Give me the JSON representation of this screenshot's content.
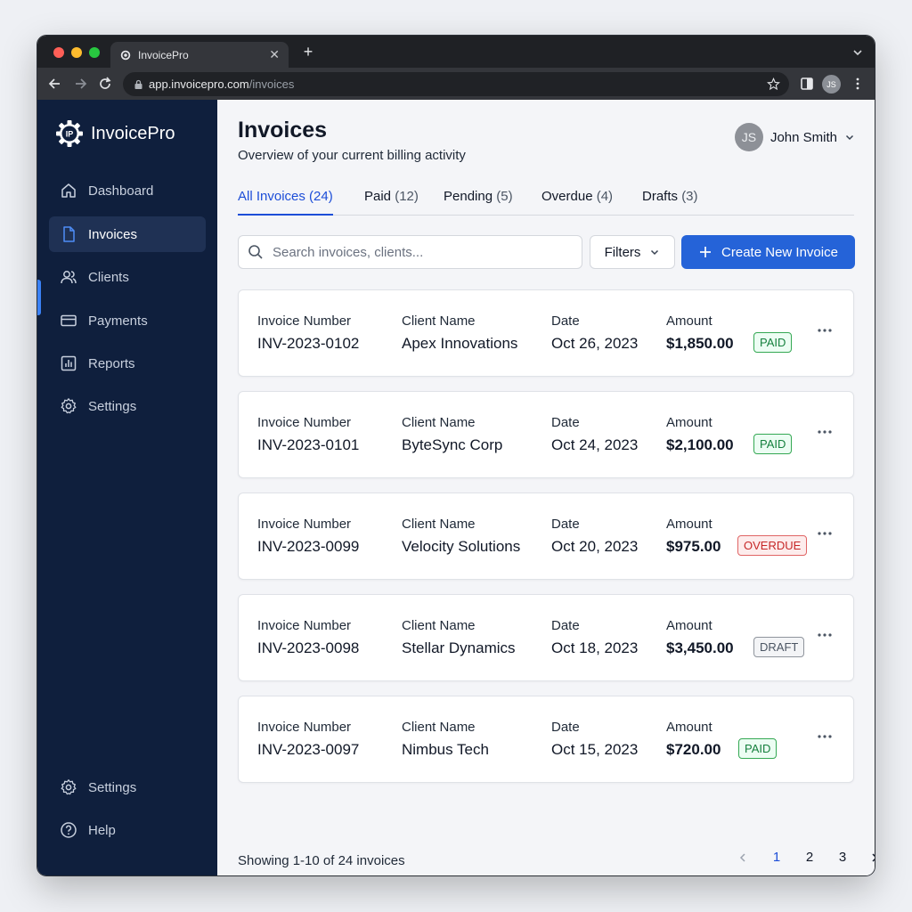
{
  "browser": {
    "tab_title": "InvoicePro",
    "url_host": "app.invoicepro.com",
    "url_path": "/invoices",
    "profile_initials": "JS",
    "traffic_light_colors": [
      "#ff5f57",
      "#febc2e",
      "#28c840"
    ]
  },
  "sidebar": {
    "brand": "InvoicePro",
    "brand_icon_text": "IP",
    "items": [
      {
        "label": "Dashboard",
        "icon": "home-icon"
      },
      {
        "label": "Invoices",
        "icon": "document-icon",
        "active": true
      },
      {
        "label": "Clients",
        "icon": "users-icon"
      },
      {
        "label": "Payments",
        "icon": "credit-card-icon"
      },
      {
        "label": "Reports",
        "icon": "bar-chart-icon"
      },
      {
        "label": "Settings",
        "icon": "gear-icon"
      }
    ],
    "bottom_items": [
      {
        "label": "Settings",
        "icon": "gear-icon"
      },
      {
        "label": "Help",
        "icon": "help-icon"
      }
    ]
  },
  "header": {
    "title": "Invoices",
    "subtitle": "Overview of your current billing activity",
    "user_name": "John Smith",
    "user_initials": "JS"
  },
  "tabs": [
    {
      "label": "All Invoices",
      "count": "(24)",
      "active": true
    },
    {
      "label": "Paid",
      "count": "(12)"
    },
    {
      "label": "Pending",
      "count": "(5)"
    },
    {
      "label": "Overdue",
      "count": "(4)"
    },
    {
      "label": "Drafts",
      "count": "(3)"
    }
  ],
  "toolbar": {
    "search_placeholder": "Search invoices, clients...",
    "filters_label": "Filters",
    "create_label": "Create New Invoice"
  },
  "columns": {
    "invoice_number": "Invoice Number",
    "client_name": "Client Name",
    "date": "Date",
    "amount": "Amount"
  },
  "invoices": [
    {
      "number": "INV-2023-0102",
      "client": "Apex Innovations",
      "date": "Oct 26, 2023",
      "amount": "$1,850.00",
      "status": "PAID"
    },
    {
      "number": "INV-2023-0101",
      "client": "ByteSync Corp",
      "date": "Oct 24, 2023",
      "amount": "$2,100.00",
      "status": "PAID"
    },
    {
      "number": "INV-2023-0099",
      "client": "Velocity Solutions",
      "date": "Oct 20, 2023",
      "amount": "$975.00",
      "status": "OVERDUE"
    },
    {
      "number": "INV-2023-0098",
      "client": "Stellar Dynamics",
      "date": "Oct 18, 2023",
      "amount": "$3,450.00",
      "status": "DRAFT"
    },
    {
      "number": "INV-2023-0097",
      "client": "Nimbus Tech",
      "date": "Oct 15, 2023",
      "amount": "$720.00",
      "status": "PAID"
    }
  ],
  "pagination": {
    "summary": "Showing 1-10 of 24 invoices",
    "pages": [
      "1",
      "2",
      "3"
    ],
    "current": "1"
  },
  "colors": {
    "sidebar_bg": "#0f1f3d",
    "accent": "#2563d8",
    "paid": "#15803d",
    "overdue": "#c62828",
    "draft": "#4b5563"
  }
}
